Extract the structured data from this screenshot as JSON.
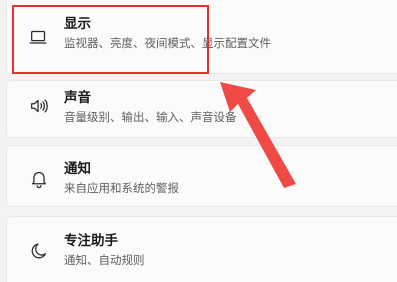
{
  "settings": {
    "items": [
      {
        "title": "显示",
        "subtitle": "监视器、亮度、夜间模式、显示配置文件",
        "icon": "monitor-icon"
      },
      {
        "title": "声音",
        "subtitle": "音量级别、输出、输入、声音设备",
        "icon": "speaker-icon"
      },
      {
        "title": "通知",
        "subtitle": "来自应用和系统的警报",
        "icon": "bell-icon"
      },
      {
        "title": "专注助手",
        "subtitle": "通知、自动规则",
        "icon": "moon-icon"
      }
    ]
  },
  "annotation": {
    "highlight_color": "#e5312d",
    "arrow_color": "#ef4a45"
  }
}
